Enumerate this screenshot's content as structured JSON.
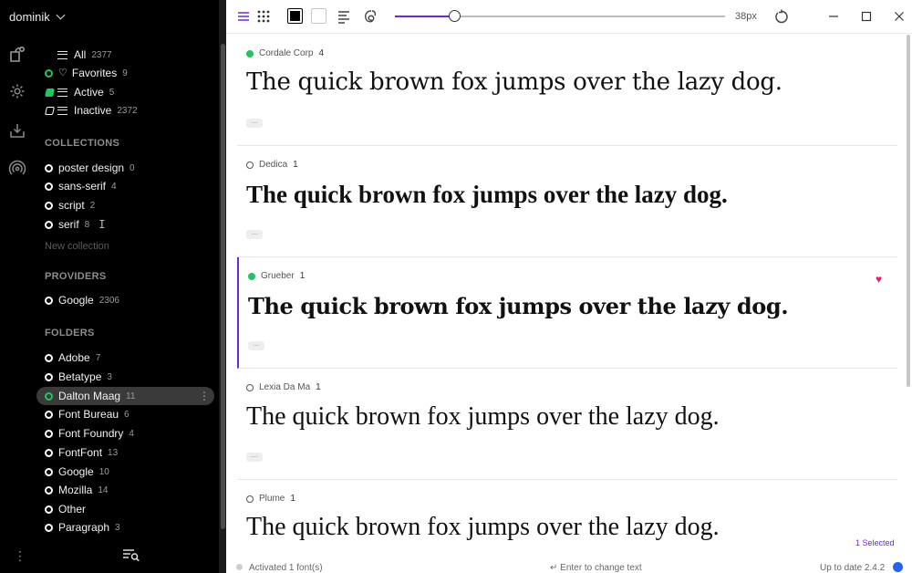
{
  "sidebar": {
    "user": "dominik",
    "smart": [
      {
        "label": "All",
        "count": "2377"
      },
      {
        "label": "Favorites",
        "count": "9"
      },
      {
        "label": "Active",
        "count": "5"
      },
      {
        "label": "Inactive",
        "count": "2372"
      }
    ],
    "collections_heading": "COLLECTIONS",
    "collections": [
      {
        "label": "poster design",
        "count": "0"
      },
      {
        "label": "sans-serif",
        "count": "4"
      },
      {
        "label": "script",
        "count": "2"
      },
      {
        "label": "serif",
        "count": "8"
      }
    ],
    "new_collection": "New collection",
    "providers_heading": "PROVIDERS",
    "providers": [
      {
        "label": "Google",
        "count": "2306"
      }
    ],
    "folders_heading": "FOLDERS",
    "folders": [
      {
        "label": "Adobe",
        "count": "7"
      },
      {
        "label": "Betatype",
        "count": "3"
      },
      {
        "label": "Dalton Maag",
        "count": "11"
      },
      {
        "label": "Font Bureau",
        "count": "6"
      },
      {
        "label": "Font Foundry",
        "count": "4"
      },
      {
        "label": "FontFont",
        "count": "13"
      },
      {
        "label": "Google",
        "count": "10"
      },
      {
        "label": "Mozilla",
        "count": "14"
      },
      {
        "label": "Other",
        "count": ""
      },
      {
        "label": "Paragraph",
        "count": "3"
      }
    ],
    "more_glyph": "⋮"
  },
  "toolbar": {
    "size_readout": "38px",
    "size_level": 0.18
  },
  "fonts": [
    {
      "name": "Cordale Corp",
      "count": "4",
      "active": true,
      "sample": "The quick brown fox jumps over the lazy dog.",
      "chip": "...",
      "favorite": false
    },
    {
      "name": "Dedica",
      "count": "1",
      "active": false,
      "sample": "The quick brown fox jumps over the lazy dog.",
      "chip": "...",
      "favorite": false
    },
    {
      "name": "Grueber",
      "count": "1",
      "active": true,
      "sample": "The quick brown fox jumps over the lazy dog.",
      "chip": "...",
      "favorite": true
    },
    {
      "name": "Lexia Da Ma",
      "count": "1",
      "active": false,
      "sample": "The quick brown fox jumps over the lazy dog.",
      "chip": "...",
      "favorite": false
    },
    {
      "name": "Plume",
      "count": "1",
      "active": false,
      "sample": "The quick brown fox jumps over the lazy dog.",
      "chip": "...",
      "favorite": false
    }
  ],
  "selected_count": "1 Selected",
  "status": {
    "left": "Activated 1 font(s)",
    "mid": "↵ Enter to change text",
    "right": "Up to date 2.4.2"
  },
  "colors": {
    "accent": "#6d28d9",
    "active": "#22c55e",
    "favorite": "#e11d74"
  }
}
